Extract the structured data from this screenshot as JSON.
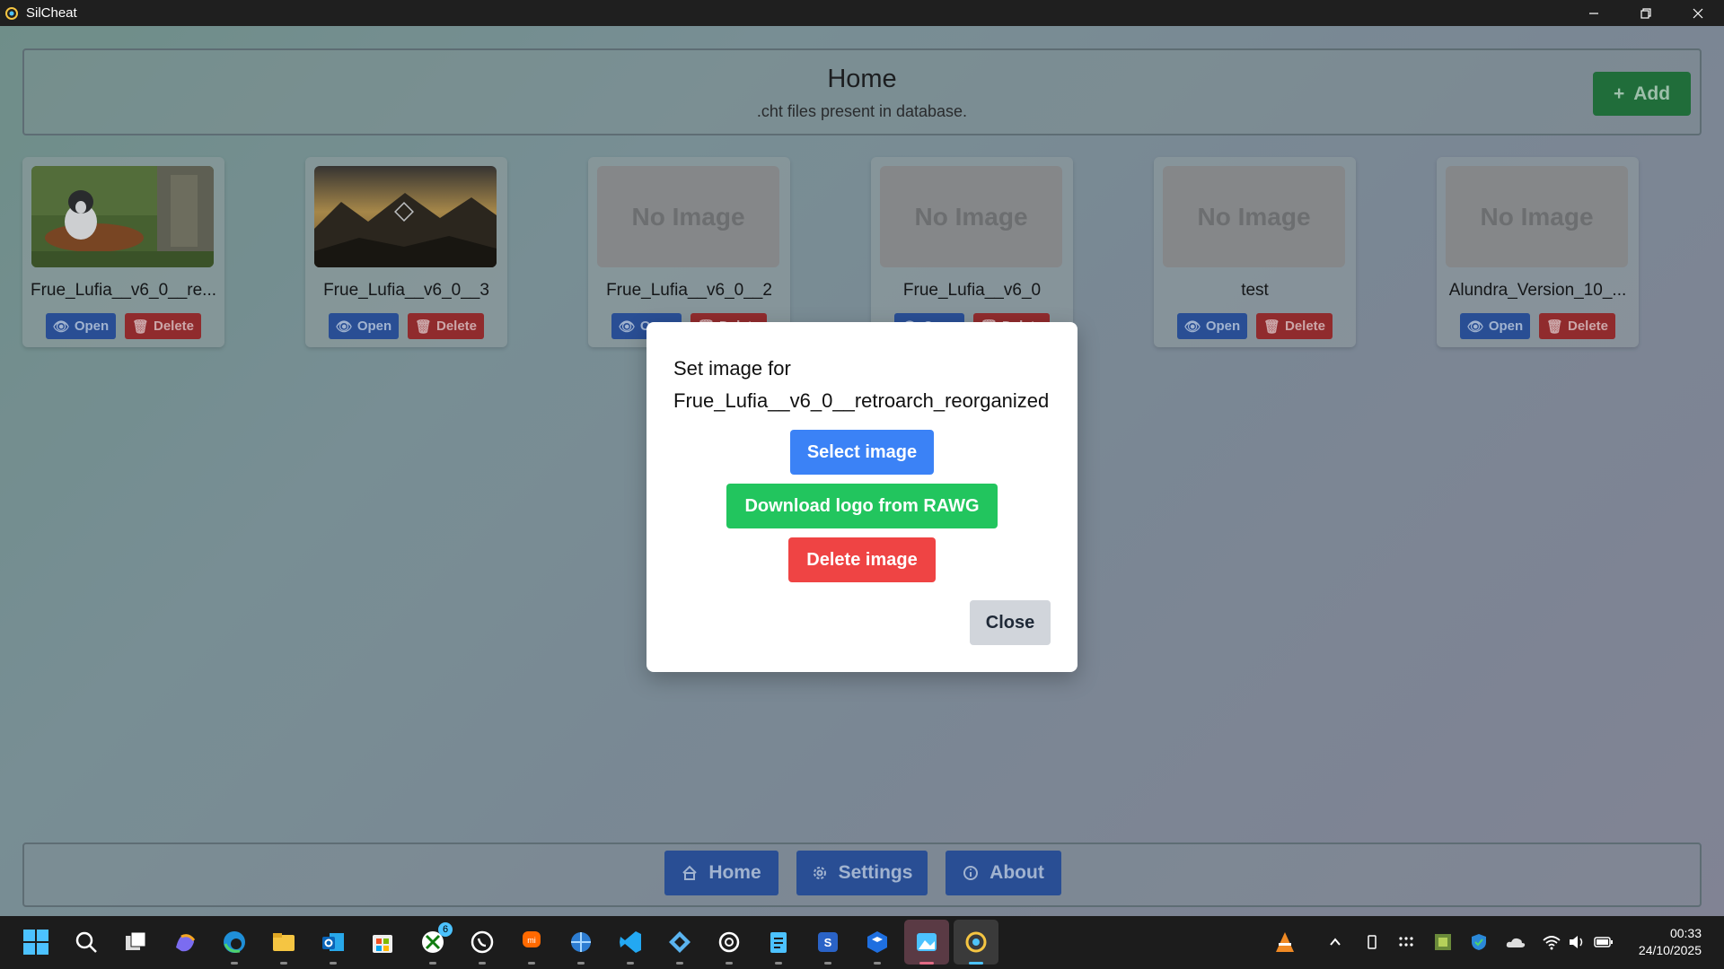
{
  "window": {
    "title": "SilCheat"
  },
  "header": {
    "title": "Home",
    "subtitle": ".cht files present in database.",
    "add_label": "Add"
  },
  "cards": [
    {
      "name": "Frue_Lufia__v6_0__re...",
      "image": "dog-photo",
      "open": "Open",
      "delete": "Delete"
    },
    {
      "name": "Frue_Lufia__v6_0__3",
      "image": "mountain-sunset-photo",
      "open": "Open",
      "delete": "Delete"
    },
    {
      "name": "Frue_Lufia__v6_0__2",
      "image": "No Image",
      "open": "Open",
      "delete": "Delete"
    },
    {
      "name": "Frue_Lufia__v6_0",
      "image": "No Image",
      "open": "Open",
      "delete": "Delete"
    },
    {
      "name": "test",
      "image": "No Image",
      "open": "Open",
      "delete": "Delete"
    },
    {
      "name": "Alundra_Version_10_...",
      "image": "No Image",
      "open": "Open",
      "delete": "Delete"
    }
  ],
  "modal": {
    "title_line1": "Set image for",
    "title_line2": "Frue_Lufia__v6_0__retroarch_reorganized",
    "select_label": "Select image",
    "download_label": "Download logo from RAWG",
    "delete_label": "Delete image",
    "close_label": "Close"
  },
  "nav": {
    "home": "Home",
    "settings": "Settings",
    "about": "About"
  },
  "taskbar": {
    "time": "00:33",
    "date": "24/10/2025",
    "xbox_badge": "6"
  },
  "colors": {
    "select": "#3b82f6",
    "download": "#22c55e",
    "delete": "#ef4444",
    "nav": "#2a55a8"
  }
}
